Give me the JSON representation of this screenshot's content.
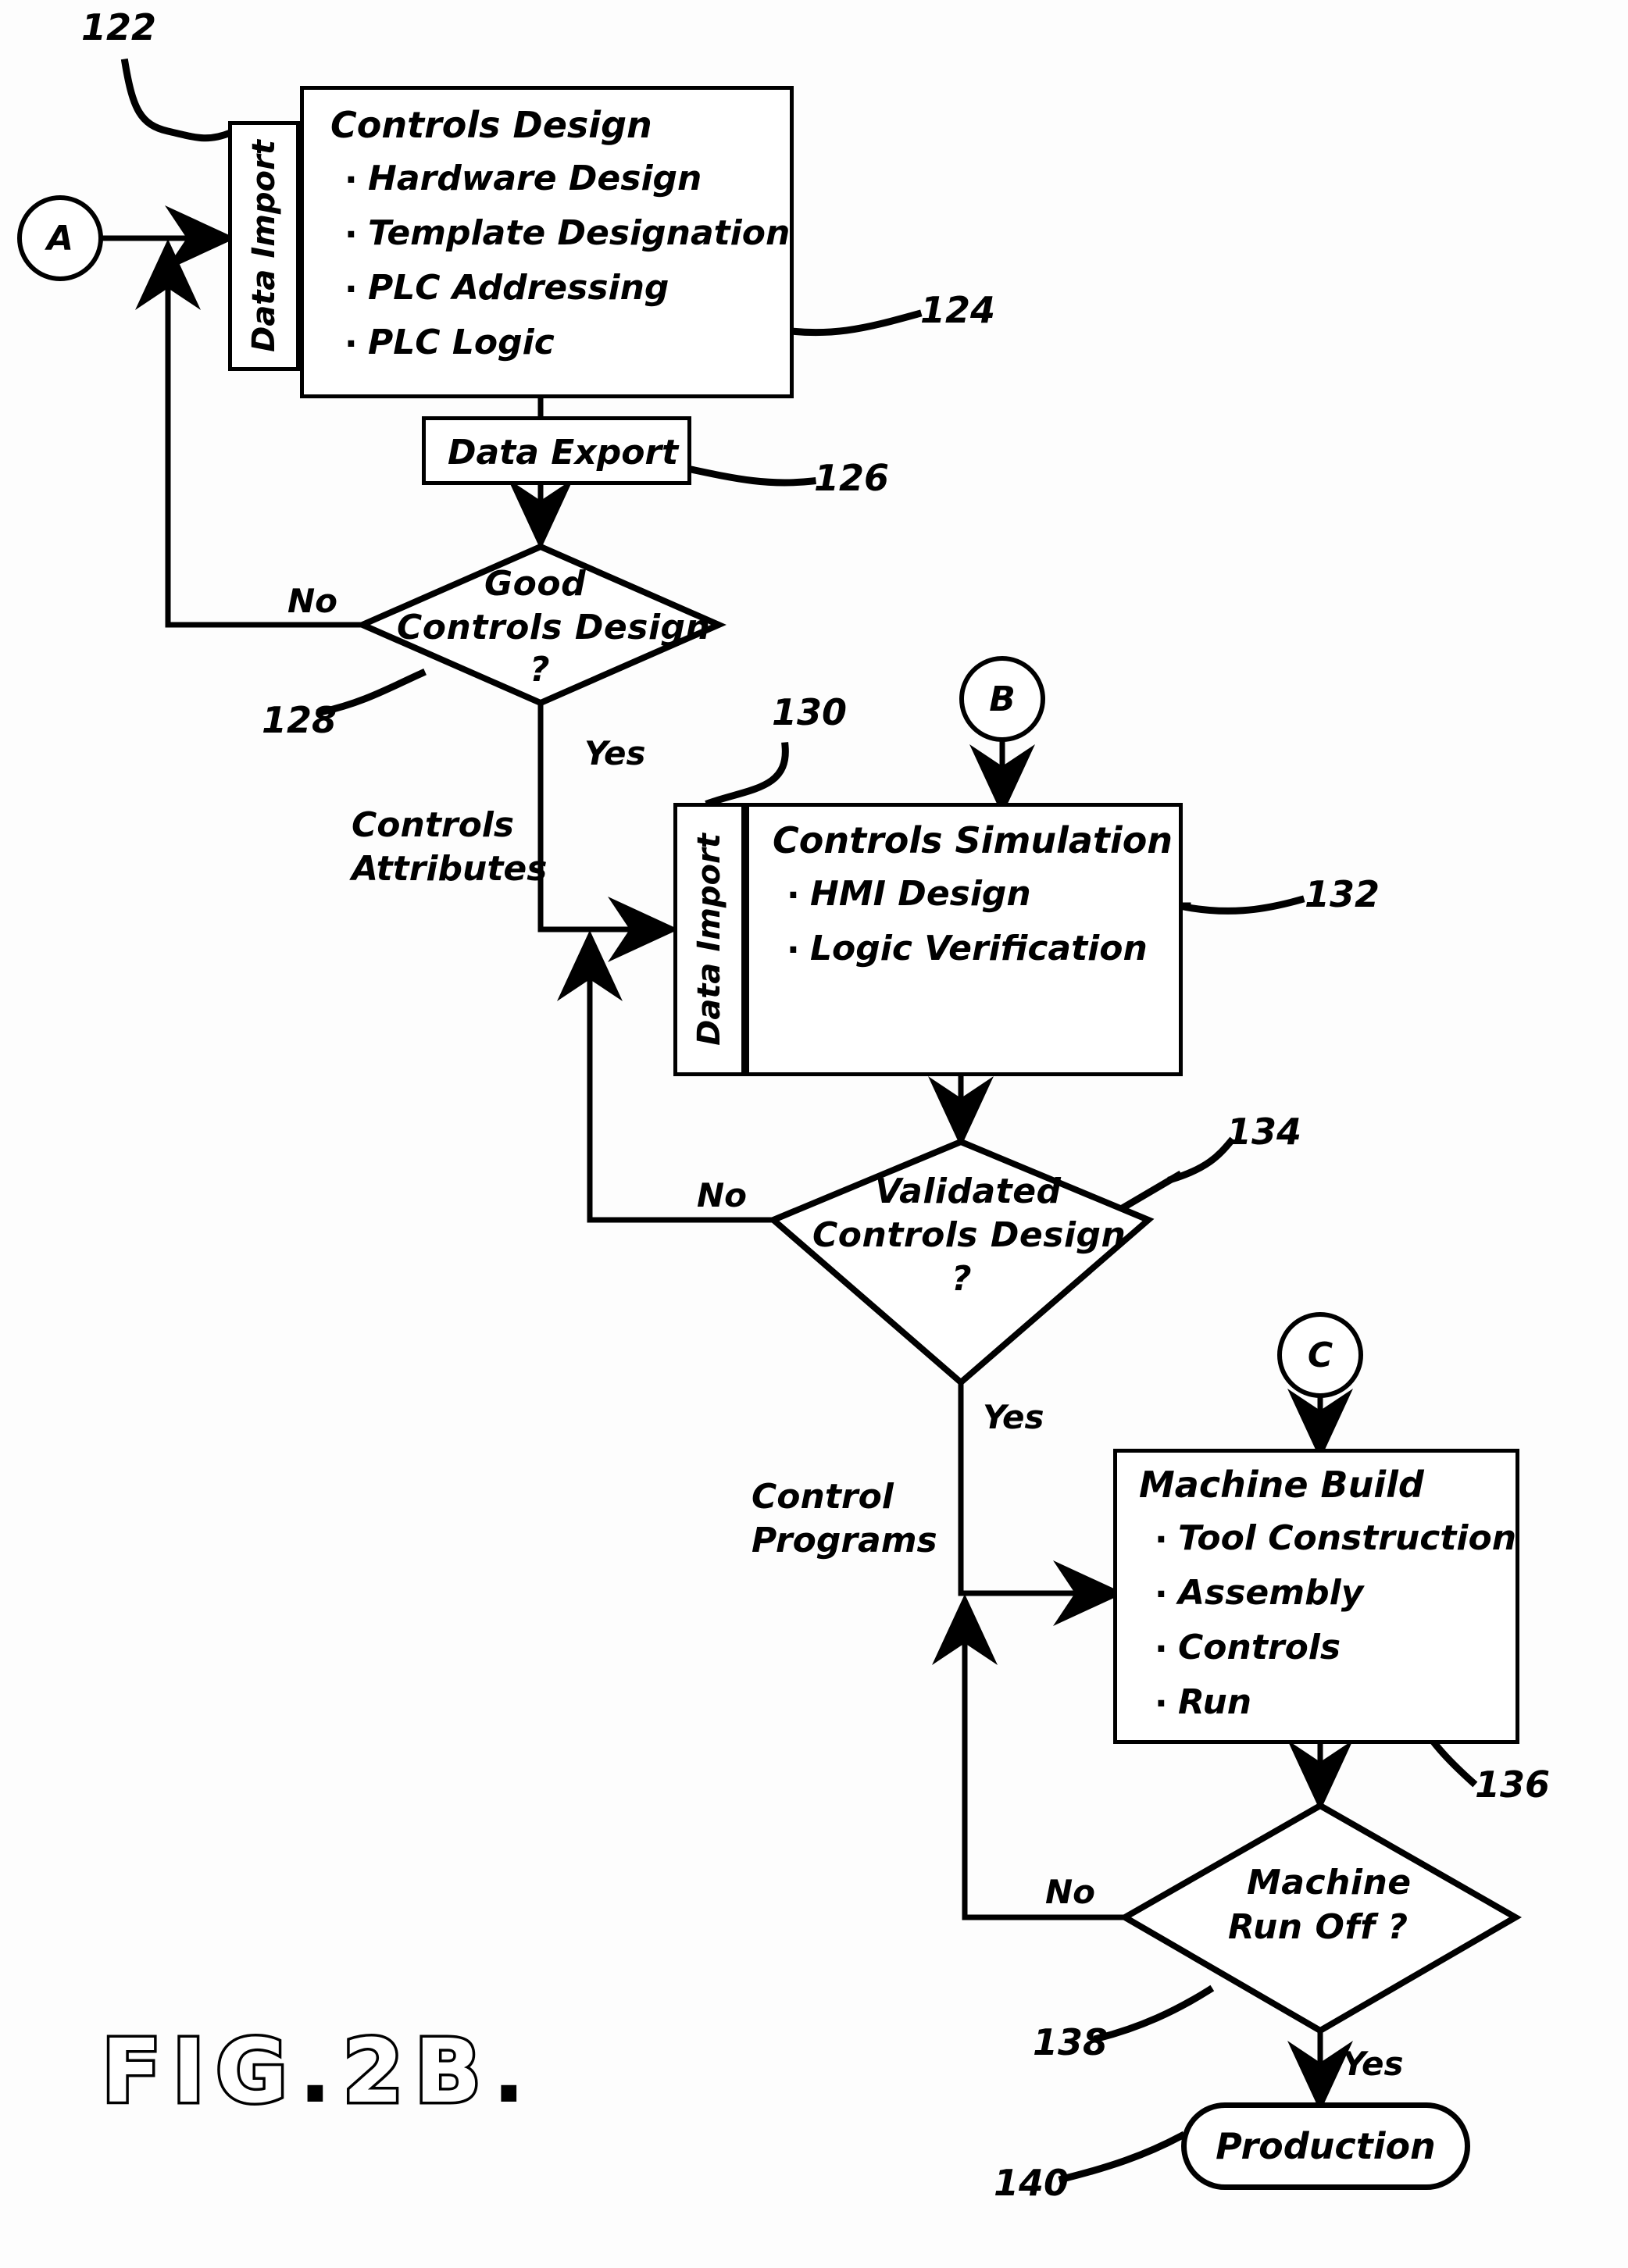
{
  "figure": {
    "caption_prefix": "FIG",
    "caption_sep": ".",
    "caption_number": "2B",
    "caption_end": "."
  },
  "connectors": [
    {
      "id": "A",
      "label": "A"
    },
    {
      "id": "B",
      "label": "B"
    },
    {
      "id": "C",
      "label": "C"
    }
  ],
  "strips": {
    "import_top": "Data Import",
    "import_mid": "Data Import"
  },
  "boxes": {
    "controls_design": {
      "ref": "124",
      "title": "Controls Design",
      "items": [
        "Hardware Design",
        "Template Designation",
        "PLC Addressing",
        "PLC Logic"
      ]
    },
    "data_export": {
      "ref": "126",
      "title": "Data Export"
    },
    "controls_simulation": {
      "ref": "132",
      "title": "Controls Simulation",
      "items": [
        "HMI Design",
        "Logic Verification"
      ]
    },
    "machine_build": {
      "ref": "136",
      "title": "Machine Build",
      "items": [
        "Tool Construction",
        "Assembly",
        "Controls",
        "Run"
      ]
    }
  },
  "decisions": {
    "good_controls_design": {
      "ref": "128",
      "line1": "Good",
      "line2": "Controls Design",
      "line3": "?",
      "no_label": "No",
      "yes_label": "Yes"
    },
    "validated_controls_design": {
      "ref": "134",
      "line1": "Validated",
      "line2": "Controls Design",
      "line3": "?",
      "no_label": "No",
      "yes_label": "Yes"
    },
    "machine_run_off": {
      "ref": "138",
      "line1": "Machine",
      "line2": "Run Off ?",
      "no_label": "No",
      "yes_label": "Yes"
    }
  },
  "terminal": {
    "ref": "140",
    "label": "Production"
  },
  "refs": {
    "data_import_top": "122",
    "data_import_mid": "130"
  },
  "flow_labels": {
    "controls_attributes_l1": "Controls",
    "controls_attributes_l2": "Attributes",
    "control_programs_l1": "Control",
    "control_programs_l2": "Programs"
  },
  "colors": {
    "ink": "#000000",
    "paper": "#ffffff"
  }
}
